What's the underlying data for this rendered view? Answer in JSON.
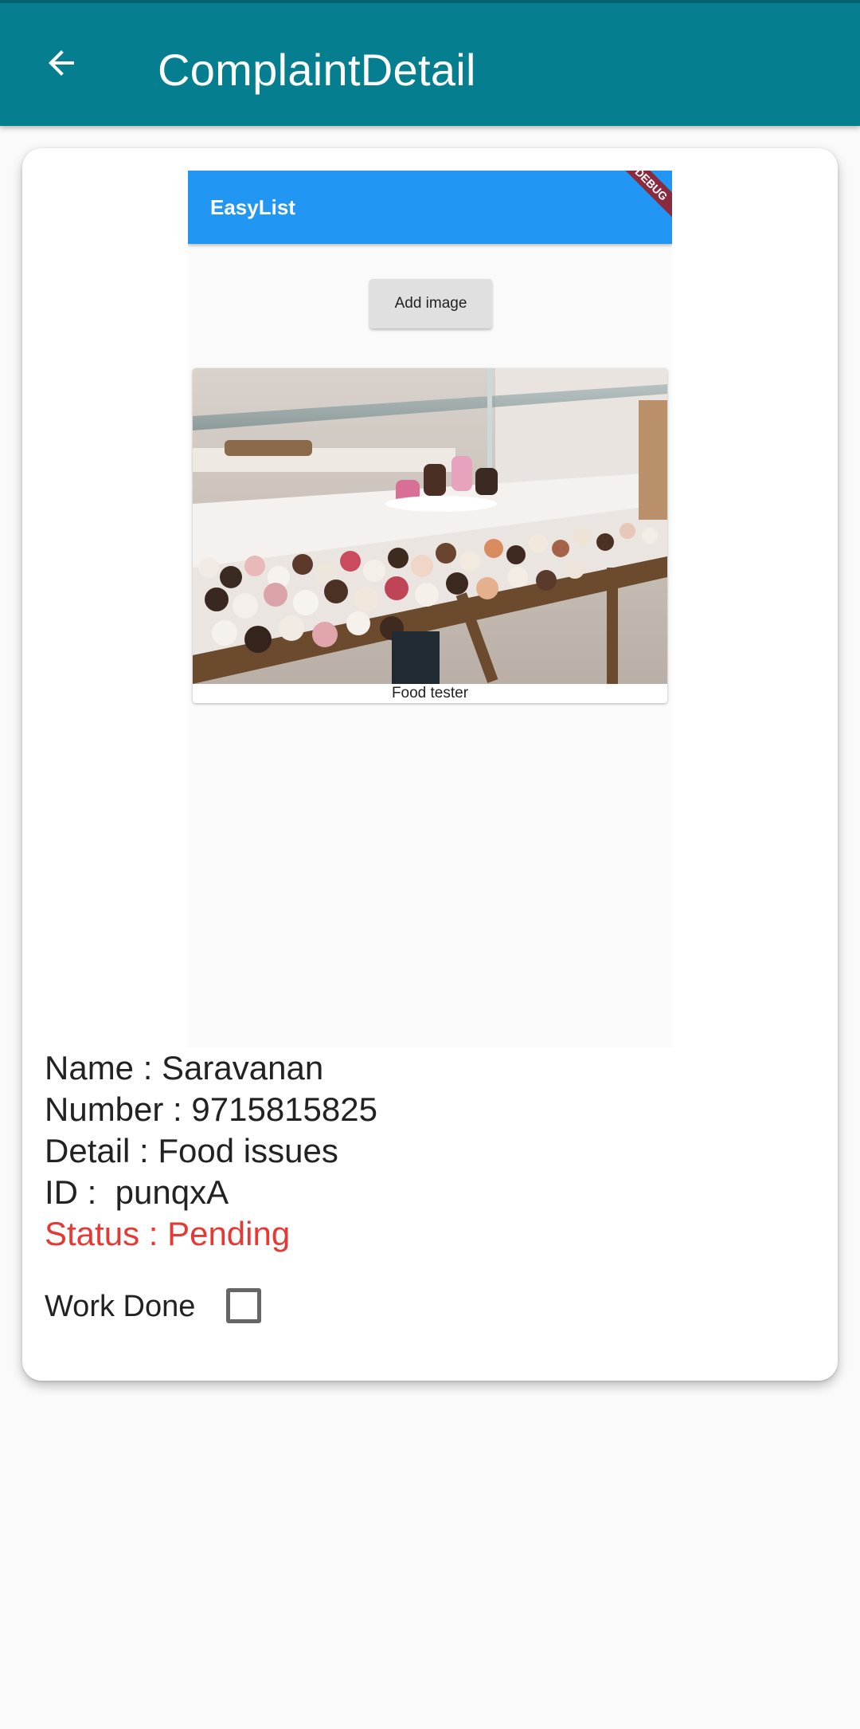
{
  "appbar": {
    "title": "ComplaintDetail",
    "back_icon": "arrow-back-icon"
  },
  "embedded_screenshot": {
    "title": "EasyList",
    "debug_ribbon": "DEBUG",
    "add_image_label": "Add image",
    "photo_caption": "Food tester"
  },
  "details": {
    "name": "Name : Saravanan",
    "number": "Number : 9715815825",
    "detail": "Detail : Food issues",
    "id": "ID :  punqxA",
    "status": "Status : Pending"
  },
  "work_done": {
    "label": "Work Done",
    "checked": false
  },
  "colors": {
    "appbar": "#057f8f",
    "embedded_appbar": "#2196f3",
    "status_pending": "#e53935"
  }
}
